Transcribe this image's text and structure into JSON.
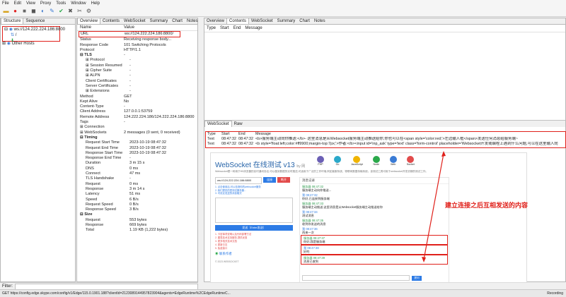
{
  "menu": [
    "File",
    "Edit",
    "View",
    "Proxy",
    "Tools",
    "Window",
    "Help"
  ],
  "toolbar_icons": [
    "folder-icon",
    "record-icon",
    "stop-icon",
    "clear-icon",
    "pause-icon",
    "pen-icon",
    "check-icon",
    "settings-icon",
    "trash-icon",
    "gear-icon"
  ],
  "structure": {
    "tabs": [
      "Structure",
      "Sequence"
    ],
    "items": [
      {
        "label": "ws://124.222.224.186:8800"
      },
      {
        "label": "/"
      },
      {
        "label": ""
      },
      {
        "label": "Other Hosts"
      }
    ]
  },
  "overview": {
    "tabs": [
      "Overview",
      "Contents",
      "WebSocket",
      "Summary",
      "Chart",
      "Notes"
    ],
    "headers": [
      "Name",
      "Value"
    ],
    "rows": [
      {
        "n": "URL",
        "v": "ws://124.222.224.186:8800/",
        "indent": 0
      },
      {
        "n": "Status",
        "v": "Receiving response body...",
        "indent": 0
      },
      {
        "n": "Response Code",
        "v": "101 Switching Protocols",
        "indent": 0
      },
      {
        "n": "Protocol",
        "v": "HTTP/1.1",
        "indent": 0
      },
      {
        "n": "TLS",
        "v": "-",
        "indent": 0,
        "group": true
      },
      {
        "n": "Protocol",
        "v": "-",
        "indent": 1,
        "exp": true
      },
      {
        "n": "Session Resumed",
        "v": "-",
        "indent": 1,
        "exp": true
      },
      {
        "n": "Cipher Suite",
        "v": "-",
        "indent": 1,
        "exp": true
      },
      {
        "n": "ALPN",
        "v": "-",
        "indent": 1,
        "exp": true
      },
      {
        "n": "Client Certificates",
        "v": "-",
        "indent": 1
      },
      {
        "n": "Server Certificates",
        "v": "-",
        "indent": 1
      },
      {
        "n": "Extensions",
        "v": "-",
        "indent": 1,
        "exp": true
      },
      {
        "n": "Method",
        "v": "GET",
        "indent": 0
      },
      {
        "n": "Kept Alive",
        "v": "No",
        "indent": 0
      },
      {
        "n": "Content-Type",
        "v": "-",
        "indent": 0
      },
      {
        "n": "Client Address",
        "v": "127.0.0.1:53759",
        "indent": 0
      },
      {
        "n": "Remote Address",
        "v": "124.222.224.186/124.222.224.186:8800",
        "indent": 0
      },
      {
        "n": "Tags",
        "v": "-",
        "indent": 0
      },
      {
        "n": "Connection",
        "v": "",
        "indent": 0,
        "exp": true
      },
      {
        "n": "WebSockets",
        "v": "2 messages (0 sent, 0 received)",
        "indent": 0,
        "exp": true
      },
      {
        "n": "Timing",
        "v": "",
        "indent": 0,
        "group": true
      },
      {
        "n": "Request Start Time",
        "v": "2023-10-19 08:47:32",
        "indent": 1
      },
      {
        "n": "Request End Time",
        "v": "2023-10-19 08:47:32",
        "indent": 1
      },
      {
        "n": "Response Start Time",
        "v": "2023-10-19 08:47:32",
        "indent": 1
      },
      {
        "n": "Response End Time",
        "v": "-",
        "indent": 1
      },
      {
        "n": "Duration",
        "v": "3 m 15 s",
        "indent": 1
      },
      {
        "n": "DNS",
        "v": "0 ms",
        "indent": 1
      },
      {
        "n": "Connect",
        "v": "47 ms",
        "indent": 1
      },
      {
        "n": "TLS Handshake",
        "v": "-",
        "indent": 1
      },
      {
        "n": "Request",
        "v": "0 ms",
        "indent": 1
      },
      {
        "n": "Response",
        "v": "3 m 14 s",
        "indent": 1
      },
      {
        "n": "Latency",
        "v": "51 ms",
        "indent": 1
      },
      {
        "n": "Speed",
        "v": "6 B/s",
        "indent": 1
      },
      {
        "n": "Request Speed",
        "v": "0 B/s",
        "indent": 1
      },
      {
        "n": "Response Speed",
        "v": "3 B/s",
        "indent": 1
      },
      {
        "n": "Size",
        "v": "",
        "indent": 0,
        "group": true
      },
      {
        "n": "Request",
        "v": "553 bytes",
        "indent": 1
      },
      {
        "n": "Response",
        "v": "669 bytes",
        "indent": 1
      },
      {
        "n": "Total",
        "v": "1.19 KB (1,222 bytes)",
        "indent": 1
      }
    ]
  },
  "right": {
    "tabs": [
      "Overview",
      "Contents",
      "WebSocket",
      "Summary",
      "Chart",
      "Notes"
    ],
    "cols": [
      "Type",
      "Start",
      "End",
      "Message"
    ],
    "lower_tabs": [
      "WebSocket",
      "Raw"
    ],
    "msg_cols": [
      "Type",
      "Start",
      "End",
      "Message"
    ],
    "messages": [
      {
        "type": "Text",
        "start": "08:47:32",
        "end": "08:47:32",
        "msg": "<b>服务端主动向你推送:</b>- 这里消息是从Websocket服务端主动推送给你,你也可以在<span style='color:red;'>左边输入框</span>发送任何消息给服务端~"
      },
      {
        "type": "Text",
        "start": "08:47:32",
        "end": "08:47:32",
        "msg": "<b style='float:left;color:#ff9900;margin-top:7px;'>作者:</b><input id='inp_ask' type='text' class='form-control' placeholder='Websocket开发或编程上遇到什么问题,可以在这里输入向"
      }
    ]
  },
  "annotation": "建立连接之后互相发送的内容",
  "filter_label": "Filter:",
  "statusbar": "GET https://config.edge.skype.com/config/v1/Edge/115.0.1901.188?clientId=2123089144957823904&agents=EdgeRuntime%2CEdgeRuntimeC...",
  "statusbar_right": "Recording",
  "screenshot": {
    "title": "WebSocket 在线测试 v13",
    "title_by": "by 网",
    "subtitle": "Websocket是一种用于H5浏览器的实时通讯协议,可以做到数据的实时推送,可适用于广泛的工作环境,例如客服系统、物联网数据传输系统。该测试工具可用于websocket开发初期的测试工作。",
    "icons": [
      "PHP",
      "Go",
      "JavaScript",
      "Node",
      "Web",
      "Socket"
    ],
    "ws_input": "ws://124.222.224.186:8800",
    "connect_btn": "连接",
    "disconnect_btn": "断开",
    "send_btn": "发送（Enter发送）",
    "tips": [
      "1. 点击使用后,可以检测你的websocket服务",
      "2. 我们提供的是测试服务器...",
      "3. 可设定发送的消息格式"
    ],
    "links": [
      "1. 卡密事项说明以及代码部署方法",
      "2. 图表技术支持服务,提供优惠",
      "3. 更多相关技术文档",
      "4. 更新日志",
      "5. 免费接口"
    ],
    "contact": "联系作者",
    "footer": "© 2023 WEBSOCKET",
    "log_header": "消息记录",
    "log": [
      {
        "who": "服务器 08:47:32",
        "text": "服务端主动向你推送...",
        "g": true
      },
      {
        "who": "我 08:47:32",
        "text": "你好,已连接到服务端",
        "g": false
      },
      {
        "who": "服务器 08:47:33",
        "text": "服务端主动推送:这里消息是从Websocket服务端主动推送给你",
        "g": true
      },
      {
        "who": "我 08:47:34",
        "text": "测试消息",
        "g": false
      },
      {
        "who": "服务器 08:47:35",
        "text": "收到你发送的消息",
        "g": true
      },
      {
        "who": "我 08:47:36",
        "text": "再来一次",
        "g": false
      },
      {
        "who": "服务器 08:47:37",
        "text": "你好,我是服务端",
        "g": true
      },
      {
        "who": "我 08:47:38",
        "text": "好的",
        "g": false
      },
      {
        "who": "服务器 08:47:39",
        "text": "消息已收到",
        "g": true
      }
    ],
    "ask_btn": "提问"
  }
}
